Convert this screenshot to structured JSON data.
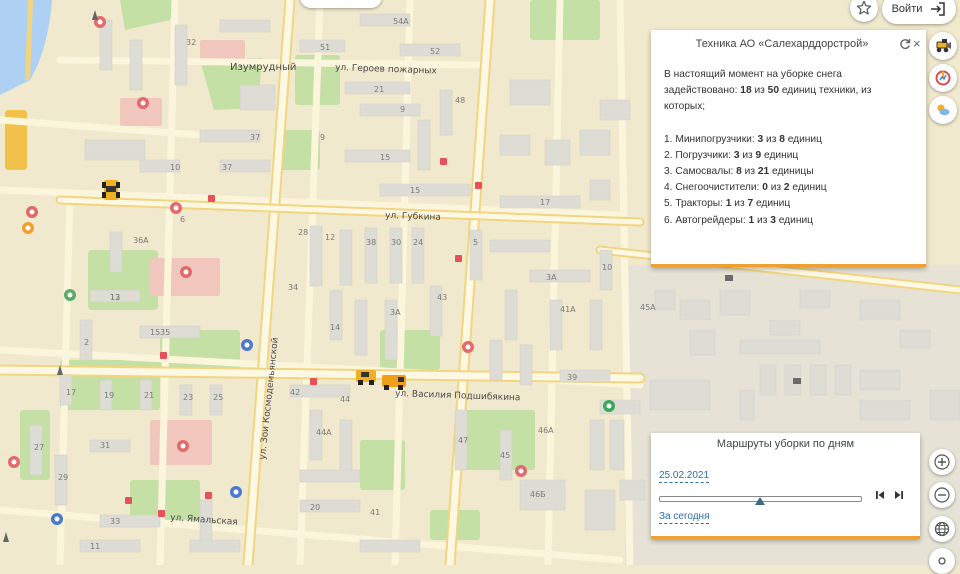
{
  "map": {
    "streets": {
      "geroev_pozharnyh": "ул. Героев пожарных",
      "gubkina": "ул. Губкина",
      "vasiliya_podshibyakina": "ул. Василия Подшибякина",
      "yamalskaya": "ул. Ямальская",
      "zoi_kosmodemyanskoy": "ул. Зои Космодемьянской",
      "izumrudny": "Изумрудный"
    },
    "buildings": [
      "54А",
      "51",
      "52",
      "32",
      "21",
      "9",
      "48",
      "37",
      "15",
      "15",
      "9",
      "10",
      "12",
      "6",
      "28",
      "38",
      "30",
      "34",
      "36А",
      "12",
      "2",
      "24",
      "5",
      "3А",
      "10",
      "3А",
      "42",
      "44",
      "13",
      "15",
      "35",
      "17",
      "19",
      "21",
      "23",
      "25",
      "27",
      "29",
      "31",
      "33",
      "11",
      "47",
      "45",
      "44А",
      "41",
      "20",
      "46А",
      "46Б",
      "17",
      "37",
      "14",
      "43",
      "45А",
      "41А",
      "39"
    ]
  },
  "header": {
    "exit_label": "Войти"
  },
  "info_panel": {
    "title": "Техника АО «Салехарддорстрой»",
    "intro_1": "В настоящий момент на уборке снега",
    "intro_2_pre": "задействовано: ",
    "intro_2_used": "18",
    "intro_2_mid": " из ",
    "intro_2_total": "50",
    "intro_2_post": " единиц техники, из",
    "intro_3": "которых;",
    "items": [
      {
        "pre": "1. Минипогрузчики: ",
        "used": "3",
        "mid": " из ",
        "total": "8",
        "post": " единиц"
      },
      {
        "pre": "2. Погрузчики: ",
        "used": "3",
        "mid": " из ",
        "total": "9",
        "post": " единиц"
      },
      {
        "pre": "3. Самосвалы: ",
        "used": "8",
        "mid": " из ",
        "total": "21",
        "post": " единицы"
      },
      {
        "pre": "4. Снегоочистители: ",
        "used": "0",
        "mid": " из ",
        "total": "2",
        "post": " единиц"
      },
      {
        "pre": "5. Тракторы: ",
        "used": "1",
        "mid": " из ",
        "total": "7",
        "post": " единиц"
      },
      {
        "pre": "6. Автогрейдеры: ",
        "used": "1",
        "mid": " из ",
        "total": "3",
        "post": " единиц"
      }
    ]
  },
  "routes_panel": {
    "title": "Маршруты уборки по дням",
    "date": "25.02.2021",
    "today_label": "За сегодня",
    "slider_position": 0.5
  },
  "colors": {
    "map_bg": "#f0e9cd",
    "road": "#fbf5dc",
    "main_road_edge": "#f2d580",
    "building": "#dddcd5",
    "park": "#c5e0a5",
    "water": "#aed0f2",
    "accent": "#f0a030",
    "link": "#2e6da4"
  },
  "icons": {
    "favorite": "star-icon",
    "login": "login-arrow-icon",
    "equipment": "snowplow-icon",
    "statistics": "chart-icon",
    "weather": "weather-icon",
    "refresh": "refresh-icon",
    "close": "close-icon",
    "zoom_in": "plus-icon",
    "zoom_out": "minus-icon",
    "layers": "globe-icon"
  }
}
